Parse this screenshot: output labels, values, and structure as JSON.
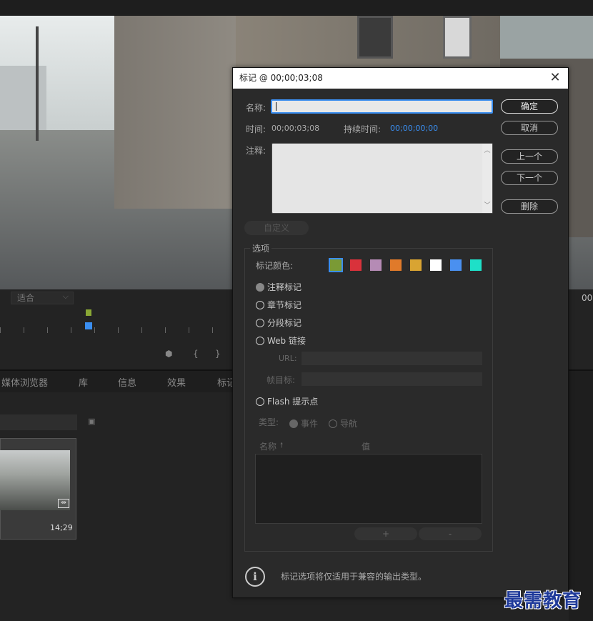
{
  "app": {
    "fit_select": "适合",
    "timecode_right": "00",
    "timeline_buttons": [
      "⬢",
      "{",
      "}"
    ],
    "panel_tabs": [
      "媒体浏览器",
      "库",
      "信息",
      "效果",
      "标记"
    ],
    "clip_duration": "14;29",
    "clip_icon": "audio-video-icon"
  },
  "dialog": {
    "title": "标记 @ 00;00;03;08",
    "name_label": "名称:",
    "name_value": "",
    "time_label": "时间:",
    "time_value": "00;00;03;08",
    "duration_label": "持续时间:",
    "duration_value": "00;00;00;00",
    "note_label": "注释:",
    "note_value": "",
    "buttons": {
      "ok": "确定",
      "cancel": "取消",
      "prev": "上一个",
      "next": "下一个",
      "delete": "删除",
      "custom": "自定义"
    },
    "options_legend": "选项",
    "color_label": "标记颜色:",
    "colors": [
      "#7a9a35",
      "#d9323b",
      "#b58bb5",
      "#e07a2a",
      "#d9a432",
      "#ffffff",
      "#4a90f0",
      "#1ee0c8"
    ],
    "selected_color_index": 0,
    "types": [
      {
        "label": "注释标记",
        "checked": true
      },
      {
        "label": "章节标记",
        "checked": false
      },
      {
        "label": "分段标记",
        "checked": false
      },
      {
        "label": "Web 链接",
        "checked": false
      }
    ],
    "url_label": "URL:",
    "frame_target_label": "帧目标:",
    "flash_label": "Flash 提示点",
    "kind_label": "类型:",
    "kind_event": "事件",
    "kind_nav": "导航",
    "table_col_name": "名称",
    "table_col_value": "值",
    "plus": "+",
    "minus": "-",
    "info_text": "标记选项将仅适用于兼容的输出类型。"
  },
  "watermark": "最需教育"
}
